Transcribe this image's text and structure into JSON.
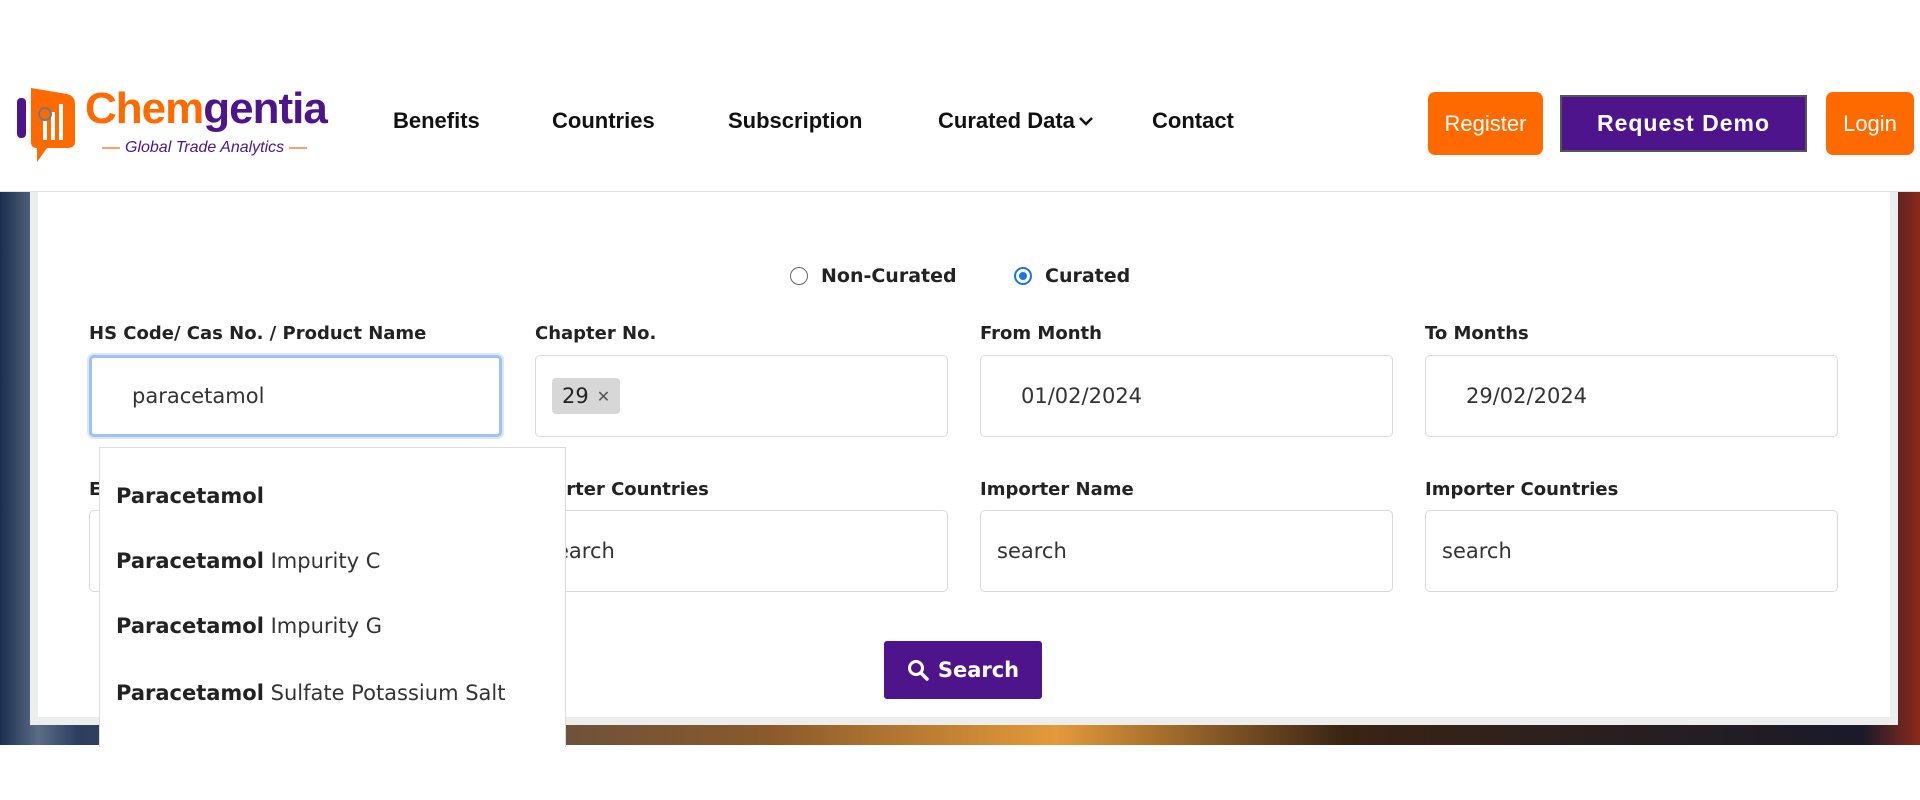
{
  "header": {
    "logo": {
      "brand_part1": "Chem",
      "brand_part2": "gentia",
      "tagline": "Global Trade Analytics"
    },
    "nav": [
      {
        "label": "Benefits"
      },
      {
        "label": "Countries"
      },
      {
        "label": "Subscription"
      },
      {
        "label": "Curated Data",
        "has_dropdown": true
      },
      {
        "label": "Contact"
      }
    ],
    "buttons": {
      "register": "Register",
      "request_demo": "Request Demo",
      "login": "Login"
    },
    "colors": {
      "orange": "#ff6a00",
      "purple": "#4e148c"
    }
  },
  "form": {
    "mode_options": [
      {
        "label": "Non-Curated",
        "checked": false
      },
      {
        "label": "Curated",
        "checked": true
      }
    ],
    "fields": [
      {
        "label": "HS Code/ Cas No. / Product Name",
        "value": "paracetamol"
      },
      {
        "label": "Chapter No.",
        "tags": [
          "29"
        ]
      },
      {
        "label": "From Month",
        "value": "01/02/2024"
      },
      {
        "label": "To Months",
        "value": "29/02/2024"
      },
      {
        "label": "E",
        "value": ""
      },
      {
        "label": "porter Countries",
        "value": "earch"
      },
      {
        "label": "Importer Name",
        "value": "search"
      },
      {
        "label": "Importer Countries",
        "value": "search"
      }
    ],
    "search_button": "Search",
    "suggestions": [
      {
        "bold": "Paracetamol",
        "rest": ""
      },
      {
        "bold": "Paracetamol",
        "rest": " Impurity C"
      },
      {
        "bold": "Paracetamol",
        "rest": " Impurity G"
      },
      {
        "bold": "Paracetamol",
        "rest": " Sulfate Potassium Salt"
      }
    ]
  }
}
